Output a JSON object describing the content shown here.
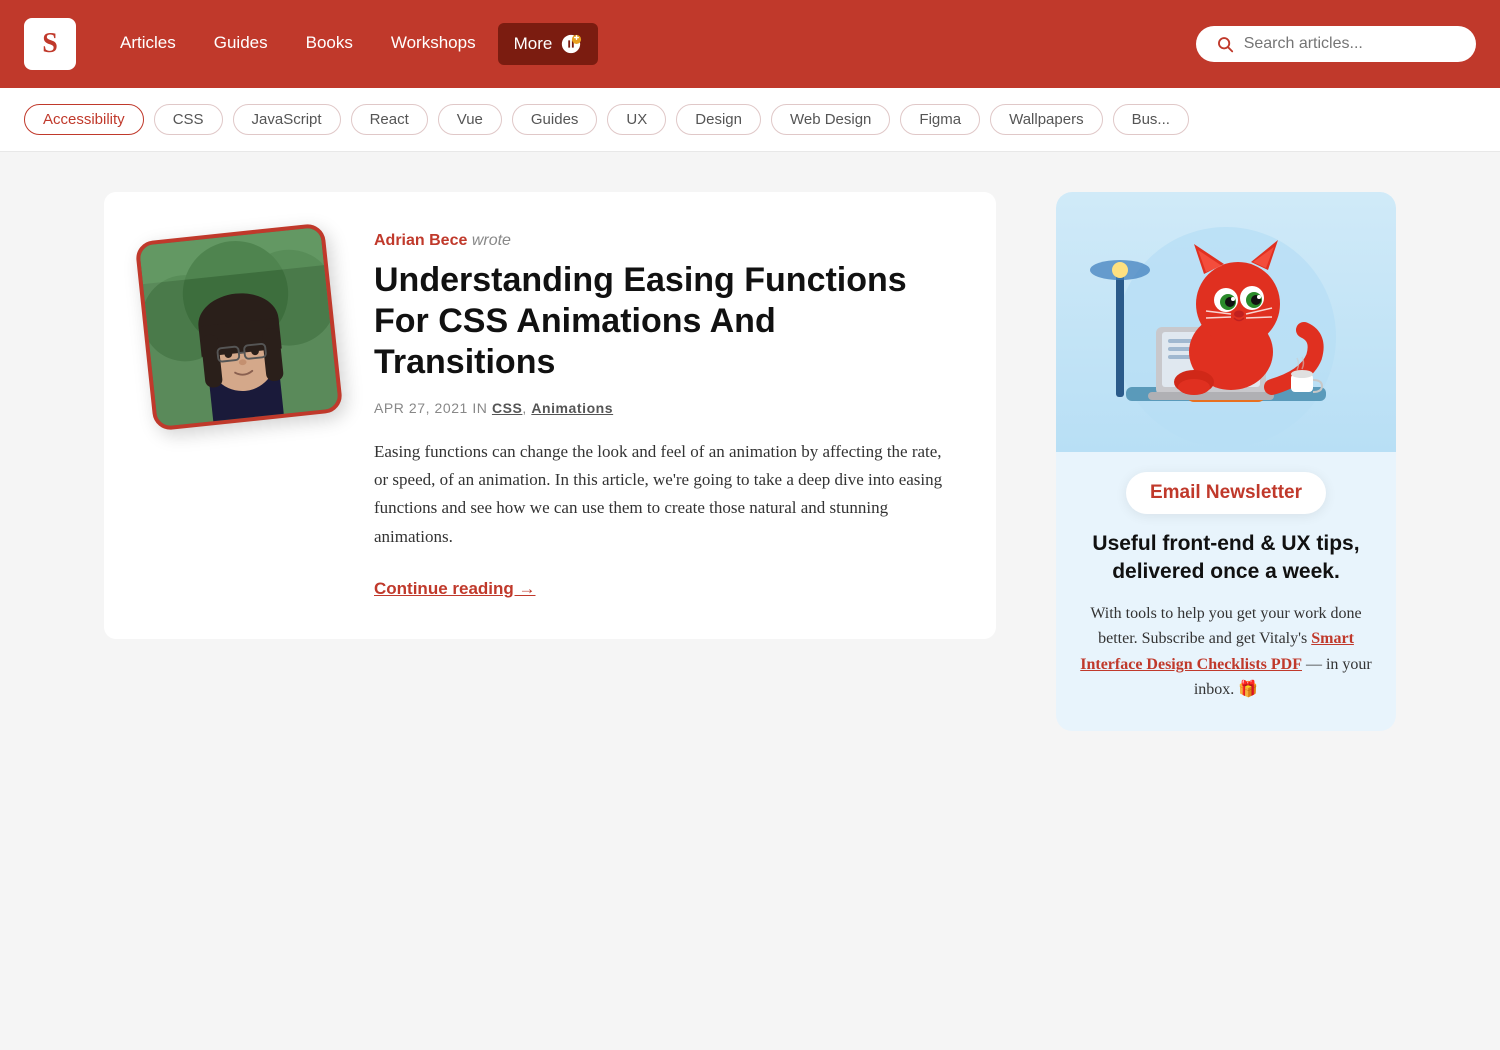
{
  "nav": {
    "logo_text": "S",
    "links": [
      {
        "label": "Articles",
        "active": false
      },
      {
        "label": "Guides",
        "active": false
      },
      {
        "label": "Books",
        "active": false
      },
      {
        "label": "Workshops",
        "active": false
      },
      {
        "label": "More",
        "active": true
      }
    ],
    "search_placeholder": "Search articles..."
  },
  "tags": [
    {
      "label": "Accessibility",
      "active": true
    },
    {
      "label": "CSS"
    },
    {
      "label": "JavaScript"
    },
    {
      "label": "React"
    },
    {
      "label": "Vue"
    },
    {
      "label": "Guides"
    },
    {
      "label": "UX"
    },
    {
      "label": "Design"
    },
    {
      "label": "Web Design"
    },
    {
      "label": "Figma"
    },
    {
      "label": "Wallpapers"
    },
    {
      "label": "Bus..."
    }
  ],
  "article": {
    "author_name": "Adrian Bece",
    "author_wrote": "wrote",
    "title": "Understanding Easing Functions For CSS Animations And Transitions",
    "date": "APR 27, 2021",
    "in_label": "in",
    "categories": [
      {
        "label": "CSS"
      },
      {
        "label": "Animations"
      }
    ],
    "excerpt": "Easing functions can change the look and feel of an animation by affecting the rate, or speed, of an animation. In this article, we're going to take a deep dive into easing functions and see how we can use them to create those natural and stunning animations.",
    "continue_label": "Continue reading →"
  },
  "newsletter": {
    "badge_label": "Email Newsletter",
    "heading": "Useful front-end & UX tips, delivered once a week.",
    "body_text": "With tools to help you get your work done better. Subscribe and get Vitaly's",
    "link_label": "Smart Interface Design Checklists PDF",
    "body_suffix": "— in your inbox. 🎁"
  }
}
